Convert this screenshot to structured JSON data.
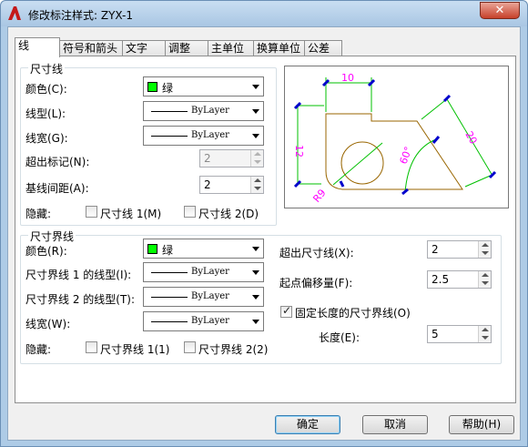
{
  "window": {
    "title": "修改标注样式: ZYX-1",
    "close_label": "✕"
  },
  "tabs": [
    "线",
    "符号和箭头",
    "文字",
    "调整",
    "主单位",
    "换算单位",
    "公差"
  ],
  "dim_lines": {
    "group_label": "尺寸线",
    "color_label": "颜色(C):",
    "color_value": "绿",
    "linetype_label": "线型(L):",
    "linetype_value": "ByLayer",
    "lineweight_label": "线宽(G):",
    "lineweight_value": "ByLayer",
    "extend_ticks_label": "超出标记(N):",
    "extend_ticks_value": "2",
    "baseline_label": "基线间距(A):",
    "baseline_value": "2",
    "suppress_label": "隐藏:",
    "suppress_1": "尺寸线 1(M)",
    "suppress_2": "尺寸线 2(D)"
  },
  "ext_lines": {
    "group_label": "尺寸界线",
    "color_label": "颜色(R):",
    "color_value": "绿",
    "lt1_label": "尺寸界线 1 的线型(I):",
    "lt1_value": "ByLayer",
    "lt2_label": "尺寸界线 2 的线型(T):",
    "lt2_value": "ByLayer",
    "lineweight_label": "线宽(W):",
    "lineweight_value": "ByLayer",
    "suppress_label": "隐藏:",
    "suppress_1": "尺寸界线 1(1)",
    "suppress_2": "尺寸界线 2(2)",
    "extend_label": "超出尺寸线(X):",
    "extend_value": "2",
    "offset_label": "起点偏移量(F):",
    "offset_value": "2.5",
    "fixed_label": "固定长度的尺寸界线(O)",
    "fixed_checked": true,
    "length_label": "长度(E):",
    "length_value": "5"
  },
  "preview": {
    "dims": [
      "10",
      "12",
      "20",
      "60°",
      "R9"
    ]
  },
  "buttons": {
    "ok": "确定",
    "cancel": "取消",
    "help": "帮助(H)"
  },
  "colors": {
    "green": "#00ff00",
    "dim_magenta": "#ff00ff",
    "geometry": "#996600",
    "dim_line": "#00c000",
    "arrow": "#0000cc"
  }
}
